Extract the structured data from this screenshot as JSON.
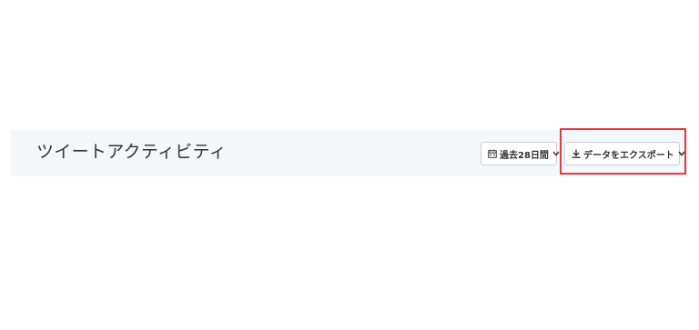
{
  "header": {
    "title": "ツイートアクティビティ"
  },
  "date_range": {
    "label": "過去28日間",
    "icon": "calendar-icon"
  },
  "export": {
    "label": "データをエクスポート",
    "icon": "download-icon"
  },
  "colors": {
    "header_background": "#f5f8fa",
    "highlight_border": "#e8373e",
    "button_border": "#c9d0d6"
  }
}
